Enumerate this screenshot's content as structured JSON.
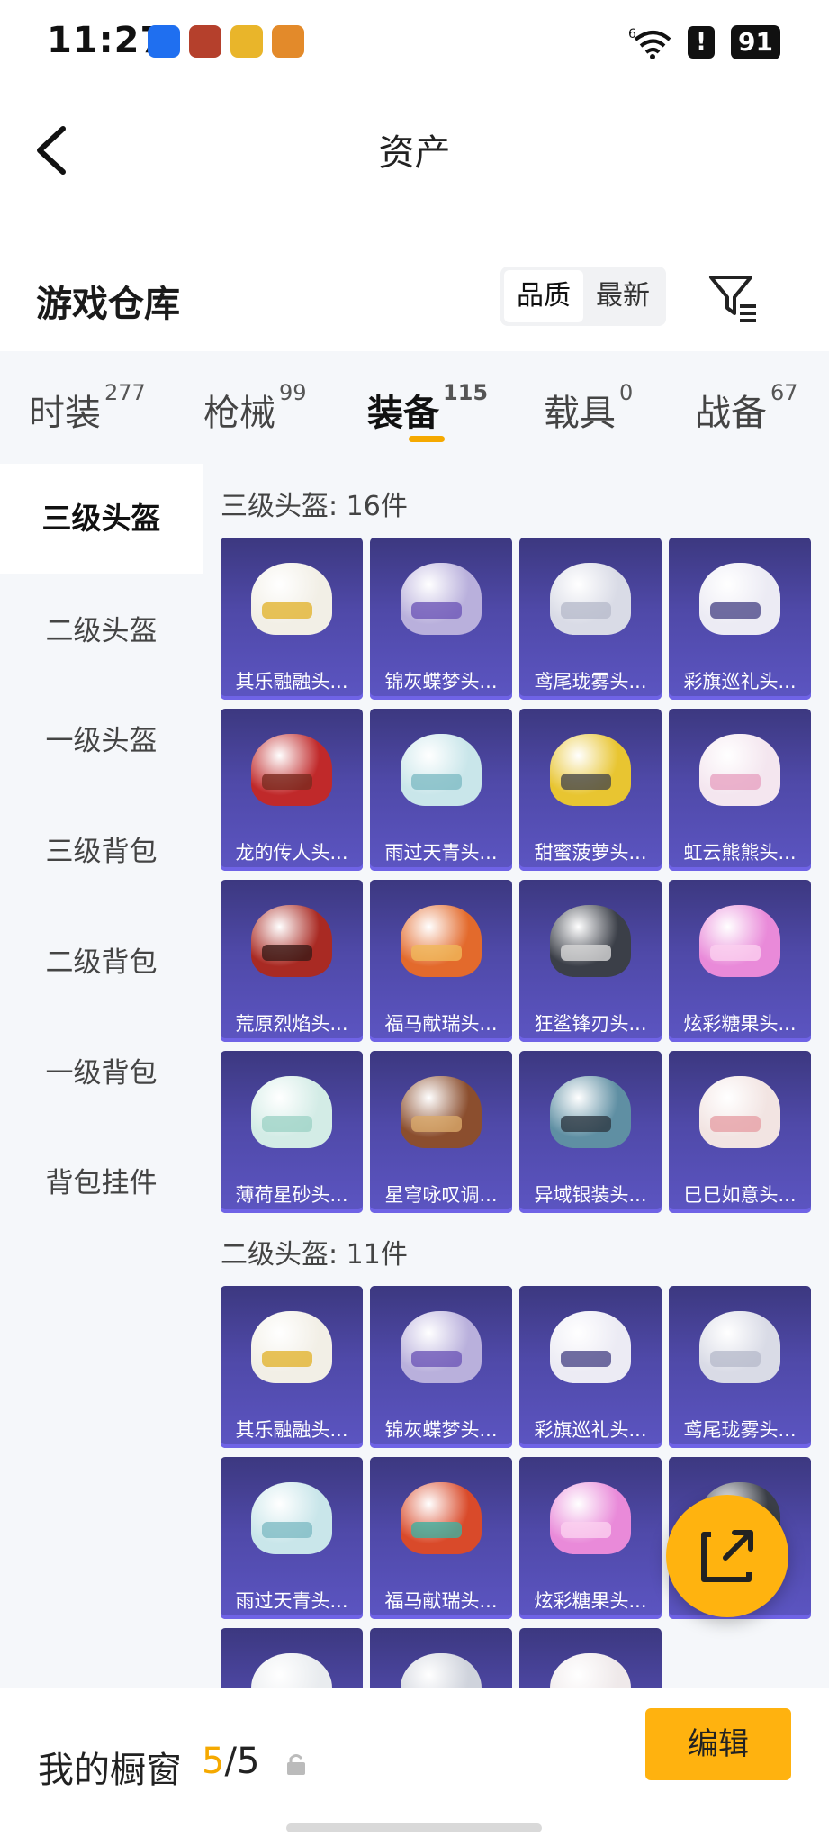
{
  "status_bar": {
    "time": "11:27",
    "signal_label": "6",
    "battery": "91",
    "alert_icon": "!"
  },
  "nav": {
    "title": "资产"
  },
  "warehouse": {
    "title": "游戏仓库",
    "sort_options": [
      "品质",
      "最新"
    ],
    "active_sort": "品质"
  },
  "category_tabs": [
    {
      "label": "时装",
      "count": "277"
    },
    {
      "label": "枪械",
      "count": "99"
    },
    {
      "label": "装备",
      "count": "115"
    },
    {
      "label": "载具",
      "count": "0"
    },
    {
      "label": "战备",
      "count": "67"
    }
  ],
  "active_tab": "装备",
  "sidebar": [
    "三级头盔",
    "二级头盔",
    "一级头盔",
    "三级背包",
    "二级背包",
    "一级背包",
    "背包挂件"
  ],
  "active_sidebar": "三级头盔",
  "sections": [
    {
      "title": "三级头盔: 16件",
      "items": [
        {
          "name": "其乐融融头...",
          "color": "#f2efe6",
          "visor": "#e2b431"
        },
        {
          "name": "锦灰蝶梦头...",
          "color": "#b9b0dc",
          "visor": "#6e58b8"
        },
        {
          "name": "鸢尾珑雾头...",
          "color": "#d9dbe6",
          "visor": "#b8bccc"
        },
        {
          "name": "彩旗巡礼头...",
          "color": "#ecebf4",
          "visor": "#4d4a8a"
        },
        {
          "name": "龙的传人头...",
          "color": "#c0292a",
          "visor": "#7a2a1f"
        },
        {
          "name": "雨过天青头...",
          "color": "#c9e6ea",
          "visor": "#7fbcc4"
        },
        {
          "name": "甜蜜菠萝头...",
          "color": "#e8c531",
          "visor": "#4a4a4a"
        },
        {
          "name": "虹云熊熊头...",
          "color": "#f4e6ef",
          "visor": "#e7a3c2"
        },
        {
          "name": "荒原烈焰头...",
          "color": "#a92a23",
          "visor": "#3b1a16"
        },
        {
          "name": "福马献瑞头...",
          "color": "#e36a2c",
          "visor": "#f0b85a"
        },
        {
          "name": "狂鲨锋刃头...",
          "color": "#3b3f48",
          "visor": "#d7d7d7"
        },
        {
          "name": "炫彩糖果头...",
          "color": "#e98ad9",
          "visor": "#fbd0ef"
        },
        {
          "name": "薄荷星砂头...",
          "color": "#d3ece6",
          "visor": "#9fd3c7"
        },
        {
          "name": "星穹咏叹调...",
          "color": "#8b4e2e",
          "visor": "#d9a96a"
        },
        {
          "name": "异域银装头...",
          "color": "#5f8fa3",
          "visor": "#2e3a44"
        },
        {
          "name": "巳巳如意头...",
          "color": "#f2e4e2",
          "visor": "#e6a0a6"
        }
      ]
    },
    {
      "title": "二级头盔: 11件",
      "items": [
        {
          "name": "其乐融融头...",
          "color": "#f2efe6",
          "visor": "#e2b431"
        },
        {
          "name": "锦灰蝶梦头...",
          "color": "#b9b0dc",
          "visor": "#6e58b8"
        },
        {
          "name": "彩旗巡礼头...",
          "color": "#ecebf4",
          "visor": "#4d4a8a"
        },
        {
          "name": "鸢尾珑雾头...",
          "color": "#d9dbe6",
          "visor": "#b8bccc"
        },
        {
          "name": "雨过天青头...",
          "color": "#c9e6ea",
          "visor": "#7fbcc4"
        },
        {
          "name": "福马献瑞头...",
          "color": "#d94a2a",
          "visor": "#3fb0a0"
        },
        {
          "name": "炫彩糖果头...",
          "color": "#e98ad9",
          "visor": "#fbd0ef"
        },
        {
          "name": "",
          "color": "#3b3f48",
          "visor": "#d7d7d7"
        },
        {
          "name": "",
          "color": "#e9ecef",
          "visor": "#cfd3d8"
        },
        {
          "name": "",
          "color": "#cfd3dc",
          "visor": "#a9aebc"
        },
        {
          "name": "",
          "color": "#efe9ea",
          "visor": "#d97c80"
        }
      ]
    }
  ],
  "showcase": {
    "label": "我的橱窗",
    "current": "5",
    "total": "5",
    "edit_label": "编辑"
  },
  "colors": {
    "accent": "#f5a900",
    "card_bg": "#4b46a3"
  }
}
